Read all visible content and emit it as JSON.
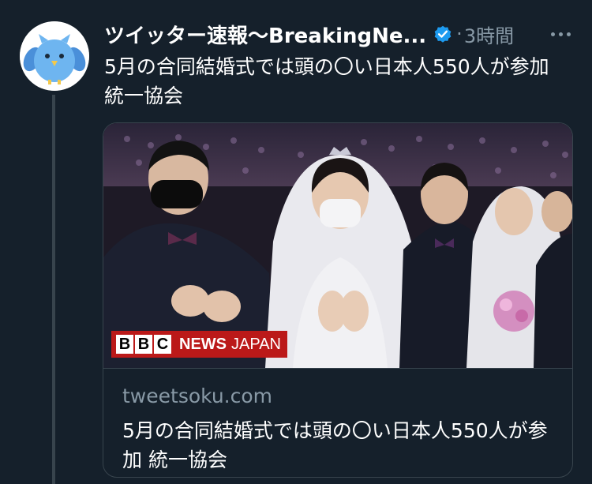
{
  "tweet": {
    "display_name": "ツイッター速報〜BreakingNe...",
    "separator": "·",
    "time": "3時間",
    "text": "5月の合同結婚式では頭の〇い日本人550人が参加 統一協会",
    "verified_icon": "verified-badge-icon",
    "more_icon": "more-horizontal-icon"
  },
  "card": {
    "domain": "tweetsoku.com",
    "title": "5月の合同結婚式では頭の〇い日本人550人が参加 統一協会",
    "logo": {
      "letters": [
        "B",
        "B",
        "C"
      ],
      "news": "NEWS",
      "japan": "JAPAN"
    }
  },
  "colors": {
    "background": "#15202b",
    "secondary_text": "#8899a6",
    "border": "#38444d",
    "verified": "#1d9bf0",
    "bbc_red": "#bb1919"
  }
}
